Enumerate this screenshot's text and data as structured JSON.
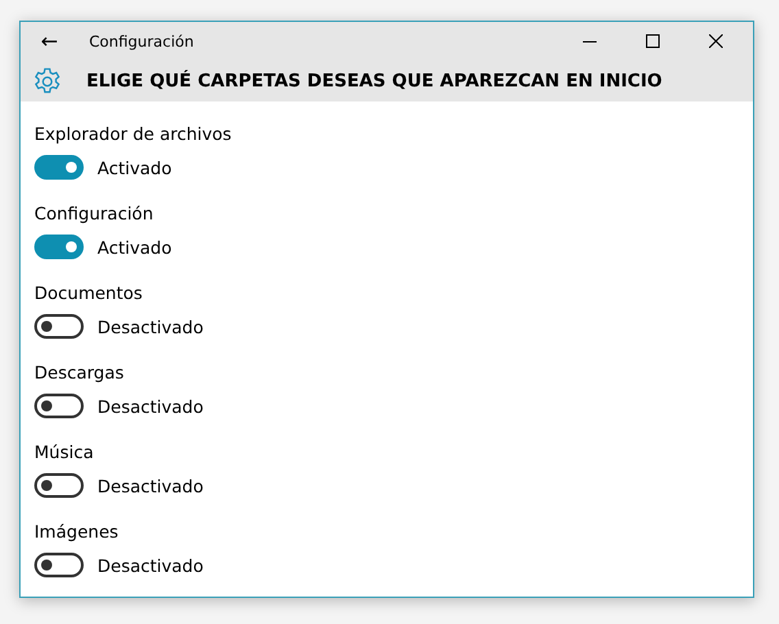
{
  "window": {
    "title": "Configuración",
    "back_icon": "←"
  },
  "header": {
    "title": "ELIGE QUÉ CARPETAS DESEAS QUE APAREZCAN EN INICIO"
  },
  "items": [
    {
      "label": "Explorador de archivos",
      "on": true,
      "state_text": "Activado"
    },
    {
      "label": "Configuración",
      "on": true,
      "state_text": "Activado"
    },
    {
      "label": "Documentos",
      "on": false,
      "state_text": "Desactivado"
    },
    {
      "label": "Descargas",
      "on": false,
      "state_text": "Desactivado"
    },
    {
      "label": "Música",
      "on": false,
      "state_text": "Desactivado"
    },
    {
      "label": "Imágenes",
      "on": false,
      "state_text": "Desactivado"
    }
  ]
}
